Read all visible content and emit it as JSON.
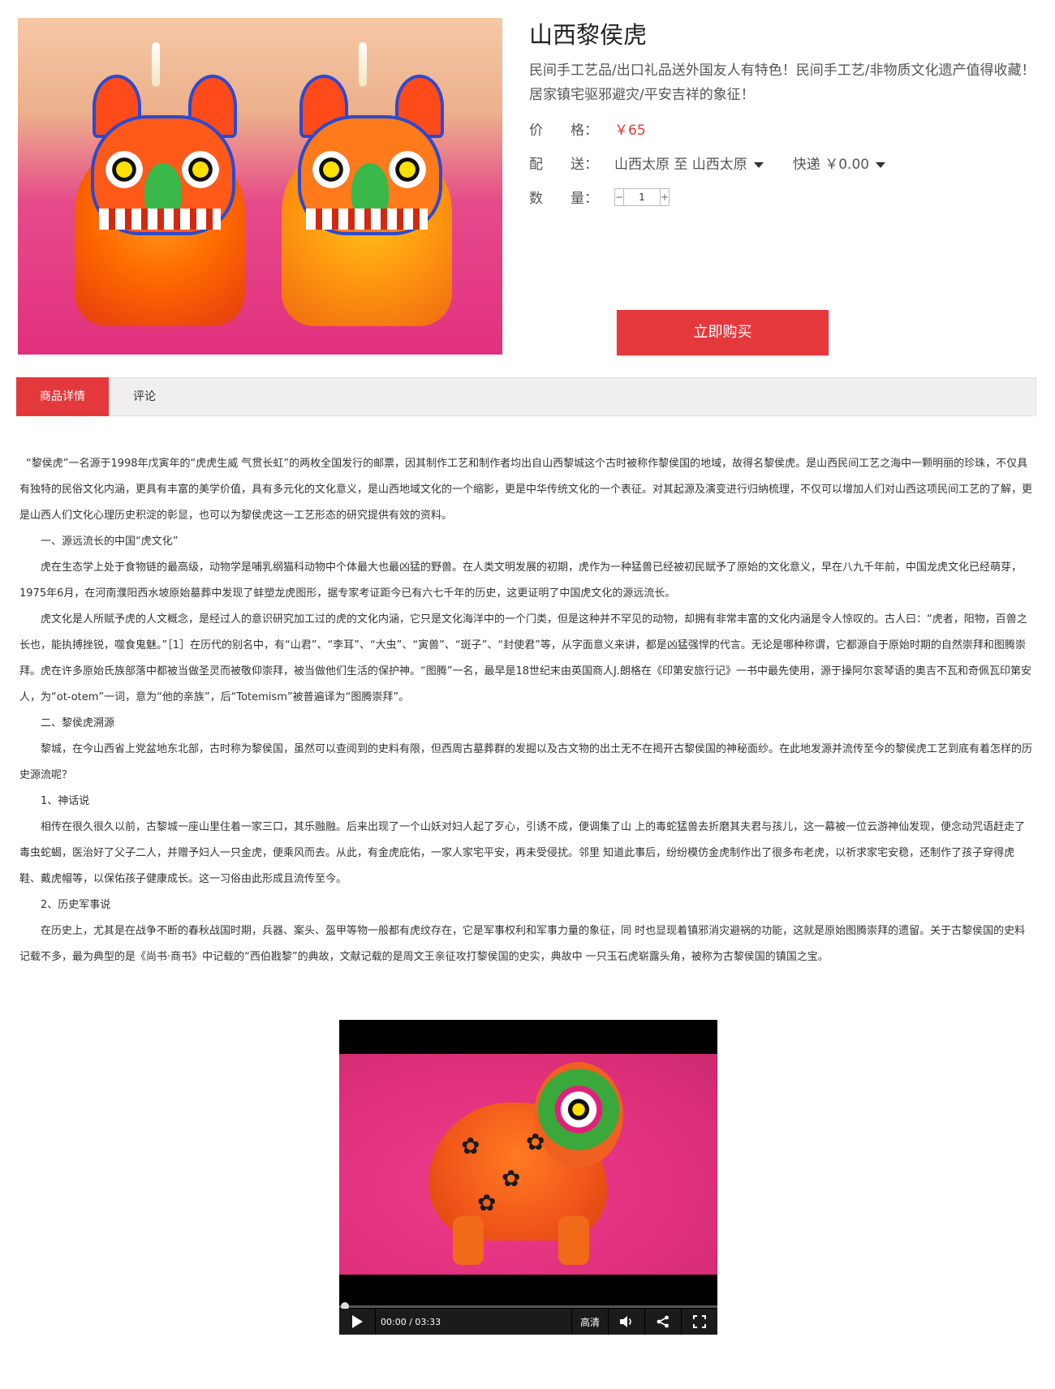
{
  "product": {
    "title": "山西黎侯虎",
    "subtitle": "民间手工艺品/出口礼品送外国友人有特色！民间手工艺/非物质文化遗产值得收藏！居家镇宅驱邪避灾/平安吉祥的象征！",
    "price_label": "价　　格：",
    "price_value": "￥65",
    "shipping_label": "配　　送：",
    "shipping_route": "山西太原 至 山西太原",
    "shipping_method": "快递",
    "shipping_fee": "￥0.00",
    "quantity_label": "数　　量：",
    "quantity_minus": "−",
    "quantity_value": "1",
    "quantity_plus": "+",
    "buy_label": "立即购买",
    "accent_color": "#e4393c",
    "image_icon": "product-photo-icon"
  },
  "tabs": [
    {
      "label": "商品详情",
      "active": true
    },
    {
      "label": "评论",
      "active": false
    }
  ],
  "article": {
    "paragraphs": [
      "“黎侯虎”一名源于1998年戊寅年的“虎虎生威 气贯长虹”的两枚全国发行的邮票，因其制作工艺和制作者均出自山西黎城这个古时被称作黎侯国的地域，故得名黎侯虎。是山西民间工艺之海中一颗明丽的珍珠，不仅具有独特的民俗文化内涵，更具有丰富的美学价值，具有多元化的文化意义，是山西地域文化的一个缩影，更是中华传统文化的一个表征。对其起源及演变进行归纳梳理，不仅可以增加人们对山西这项民间工艺的了解，更是山西人们文化心理历史积淀的彰显，也可以为黎侯虎这一工艺形态的研究提供有效的资料。",
      "一、源远流长的中国“虎文化”",
      "虎在生态学上处于食物链的最高级，动物学是哺乳纲猫科动物中个体最大也最凶猛的野兽。在人类文明发展的初期，虎作为一种猛兽已经被初民赋予了原始的文化意义，早在八九千年前，中国龙虎文化已经萌芽，1975年6月，在河南濮阳西水坡原始墓葬中发现了蚌塑龙虎图形，据专家考证距今已有六七千年的历史，这更证明了中国虎文化的源远流长。",
      "虎文化是人所赋予虎的人文概念，是经过人的意识研究加工过的虎的文化内涵，它只是文化海洋中的一个门类，但是这种并不罕见的动物，却拥有非常丰富的文化内涵是令人惊叹的。古人曰：“虎者，阳物，百兽之长也，能执搏挫锐，噬食鬼魅。”［1］在历代的别名中，有“山君”、“李耳”、“大虫”、“寅兽”、“斑子”、“封使君”等，从字面意义来讲，都是凶猛强悍的代言。无论是哪种称谓，它都源自于原始时期的自然崇拜和图腾崇拜。虎在许多原始氏族部落中都被当做圣灵而被敬仰崇拜，被当做他们生活的保护神。“图腾”一名，最早是18世纪末由英国商人J.朗格在《印第安旅行记》一书中最先使用，源于操阿尔衮琴语的奥吉不瓦和奇佩瓦印第安人，为“ot-otem”一词，意为“他的亲族”，后“Totemism”被普遍译为“图腾崇拜”。",
      "二、黎侯虎溯源",
      "黎城，在今山西省上党盆地东北部，古时称为黎侯国，虽然可以查阅到的史料有限，但西周古墓葬群的发掘以及古文物的出土无不在揭开古黎侯国的神秘面纱。在此地发源并流传至今的黎侯虎工艺到底有着怎样的历史源流呢？",
      "1、神话说",
      "相传在很久很久以前，古黎城一座山里住着一家三口，其乐融融。后来出现了一个山妖对妇人起了歹心，引诱不成，便调集了山 上的毒蛇猛兽去折磨其夫君与孩儿，这一幕被一位云游神仙发现，便念动咒语赶走了毒虫蛇蝎，医治好了父子二人，并赠予妇人一只金虎，便乘风而去。从此，有金虎庇佑，一家人家宅平安，再未受侵扰。邻里 知道此事后，纷纷模仿金虎制作出了很多布老虎，以祈求家宅安稳，还制作了孩子穿得虎鞋、戴虎帽等，以保佑孩子健康成长。这一习俗由此形成且流传至今。",
      "2、历史军事说",
      "在历史上，尤其是在战争不断的春秋战国时期，兵器、案头、盔甲等物一般都有虎纹存在，它是军事权利和军事力量的象征，同 时也显现着镇邪消灾避祸的功能，这就是原始图腾崇拜的遗留。关于古黎侯国的史料记载不多，最为典型的是《尚书·商书》中记载的“西伯戡黎”的典故，文献记载的是周文王亲征攻打黎侯国的史实，典故中 一只玉石虎崭露头角，被称为古黎侯国的镇国之宝。"
    ]
  },
  "video": {
    "time": "00:00 / 03:33",
    "quality": "高清",
    "progress": 0,
    "icons": [
      "play-icon",
      "volume-icon",
      "share-icon",
      "fullscreen-icon"
    ]
  }
}
